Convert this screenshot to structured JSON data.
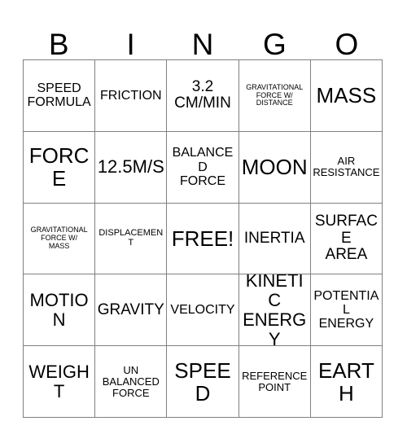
{
  "card": {
    "header_letters": [
      "B",
      "I",
      "N",
      "G",
      "O"
    ],
    "free_space_label": "FREE!",
    "text_color": "#000000",
    "background_color": "#ffffff",
    "border_color": "#808080",
    "columns": 5,
    "rows": 5
  },
  "rows": [
    {
      "cells": [
        {
          "text": "SPEED\nFORMULA",
          "size": "md"
        },
        {
          "text": "FRICTION",
          "size": "md"
        },
        {
          "text": "3.2\nCM/MIN",
          "size": "lg"
        },
        {
          "text": "GRAVITATIONAL\nFORCE W/\nDISTANCE",
          "size": "xxs"
        },
        {
          "text": "MASS",
          "size": "xxl"
        }
      ]
    },
    {
      "cells": [
        {
          "text": "FORCE",
          "size": "xxl"
        },
        {
          "text": "12.5M/S",
          "size": "xl"
        },
        {
          "text": "BALANCED\nFORCE",
          "size": "md"
        },
        {
          "text": "MOON",
          "size": "xxl"
        },
        {
          "text": "AIR\nRESISTANCE",
          "size": "sm"
        }
      ]
    },
    {
      "cells": [
        {
          "text": "GRAVITATIONAL\nFORCE W/\nMASS",
          "size": "xxs"
        },
        {
          "text": "DISPLACEMENT",
          "size": "xs"
        },
        {
          "text": "FREE!",
          "size": "xxl"
        },
        {
          "text": "INERTIA",
          "size": "lg"
        },
        {
          "text": "SURFACE\nAREA",
          "size": "lg"
        }
      ]
    },
    {
      "cells": [
        {
          "text": "MOTION",
          "size": "xl"
        },
        {
          "text": "GRAVITY",
          "size": "lg"
        },
        {
          "text": "VELOCITY",
          "size": "md"
        },
        {
          "text": "KINETIC\nENERGY",
          "size": "xl"
        },
        {
          "text": "POTENTIAL\nENERGY",
          "size": "md"
        }
      ]
    },
    {
      "cells": [
        {
          "text": "WEIGHT",
          "size": "xl"
        },
        {
          "text": "UN\nBALANCED\nFORCE",
          "size": "sm"
        },
        {
          "text": "SPEED",
          "size": "xxl"
        },
        {
          "text": "REFERENCE\nPOINT",
          "size": "sm"
        },
        {
          "text": "EARTH",
          "size": "xxl"
        }
      ]
    }
  ]
}
